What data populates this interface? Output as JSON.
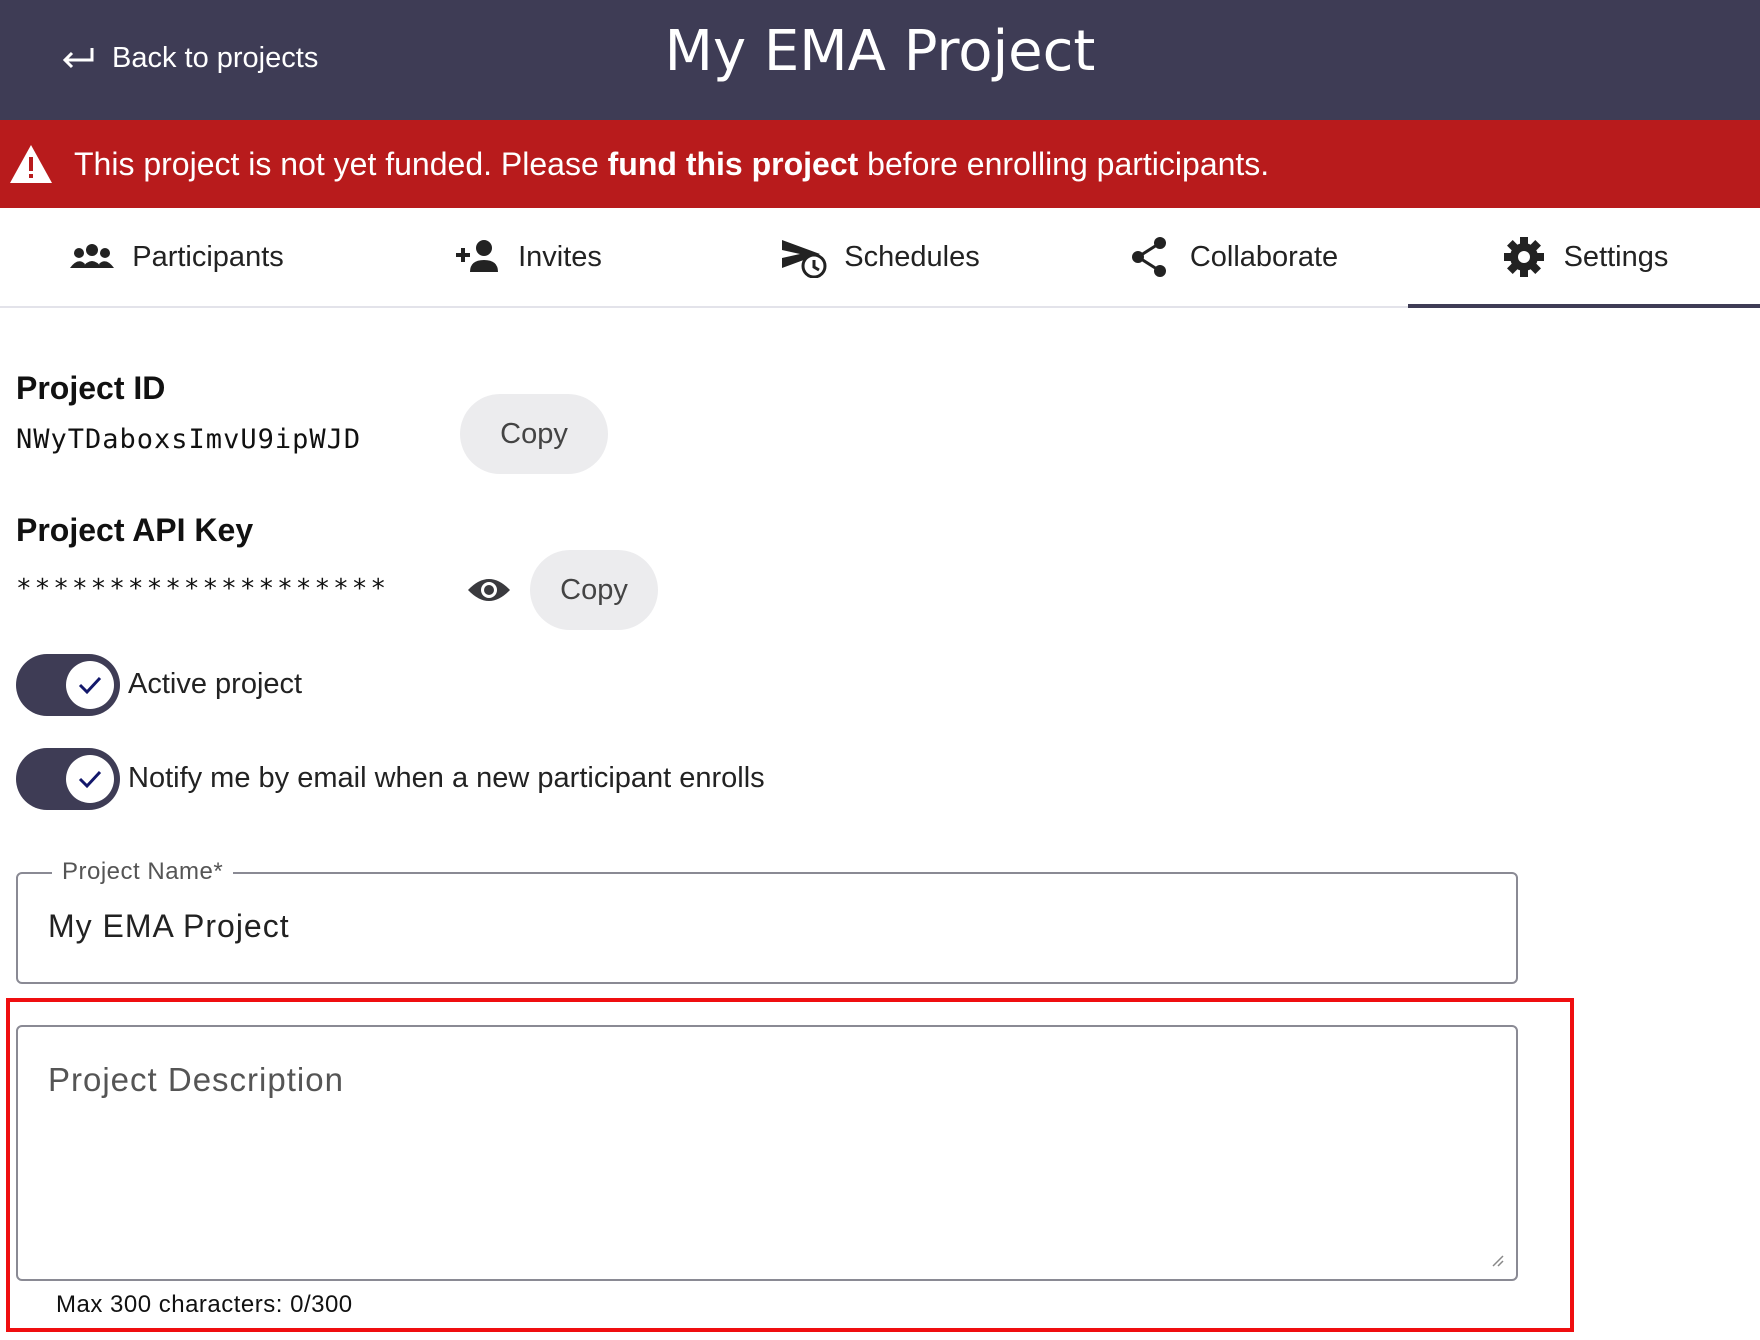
{
  "header": {
    "back_label": "Back to projects",
    "title": "My EMA Project"
  },
  "alert": {
    "icon": "warning-triangle-icon",
    "text_before": "This project is not yet funded. Please ",
    "link_text": "fund this project",
    "text_after": " before enrolling participants.",
    "color": "#b81b1c"
  },
  "tabs": [
    {
      "label": "Participants",
      "icon": "participants-icon"
    },
    {
      "label": "Invites",
      "icon": "person-add-icon"
    },
    {
      "label": "Schedules",
      "icon": "schedule-send-icon"
    },
    {
      "label": "Collaborate",
      "icon": "share-icon"
    },
    {
      "label": "Settings",
      "icon": "gear-icon",
      "active": true
    }
  ],
  "settings": {
    "project_id_label": "Project ID",
    "project_id_value": "NWyTDaboxsImvU9ipWJD",
    "api_key_label": "Project API Key",
    "api_key_masked": "********************",
    "copy_label": "Copy",
    "active_toggle_label": "Active project",
    "active_toggle_on": true,
    "notify_toggle_label": "Notify me by email when a new participant enrolls",
    "notify_toggle_on": true,
    "project_name_label": "Project Name*",
    "project_name_value": "My EMA Project",
    "project_description_placeholder": "Project Description",
    "description_helper": "Max 300 characters: 0/300"
  },
  "colors": {
    "header_bg": "#3e3c55",
    "accent": "#3e3c55",
    "highlight_border": "#ef0e10"
  }
}
